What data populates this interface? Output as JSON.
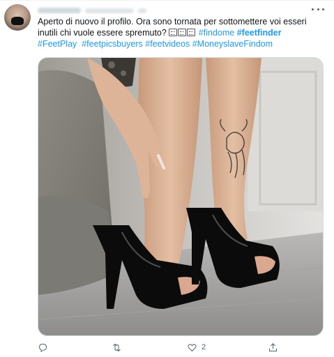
{
  "tweet": {
    "text_main": "Aperto di nuovo il profilo. Ora sono tornata per sottomettere voi esseri inutili chi vuole essere spremuto? ",
    "hashtags_line1": [
      "#findome",
      "#feetfinder"
    ],
    "hashtags_line2": [
      "#FeetPlay",
      "#feetpicsbuyers",
      "#feetvideos",
      "#MoneyslaveFindom"
    ],
    "emoji_count": 3,
    "like_count": "2"
  },
  "icons": {
    "more": "more-horizontal-icon",
    "reply": "reply-icon",
    "retweet": "retweet-icon",
    "like": "heart-icon",
    "share": "share-icon"
  },
  "colors": {
    "link": "#1d9bf0",
    "text": "#0f1419",
    "muted": "#536471",
    "border": "#cfd9de"
  }
}
